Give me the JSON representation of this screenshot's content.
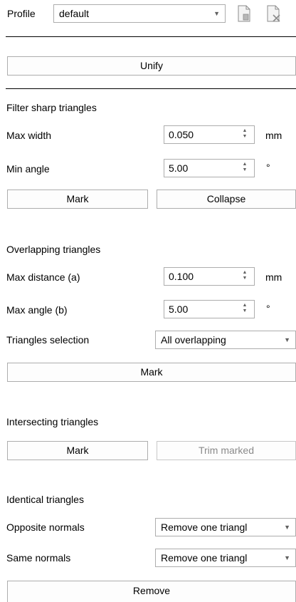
{
  "profile": {
    "label": "Profile",
    "selected": "default",
    "icons": [
      "save-document-icon",
      "delete-document-icon"
    ]
  },
  "unify_button": "Unify",
  "filter_sharp": {
    "title": "Filter sharp triangles",
    "max_width_label": "Max width",
    "max_width_value": "0.050",
    "max_width_unit": "mm",
    "min_angle_label": "Min angle",
    "min_angle_value": "5.00",
    "min_angle_unit": "°",
    "mark_button": "Mark",
    "collapse_button": "Collapse"
  },
  "overlapping": {
    "title": "Overlapping triangles",
    "max_distance_label": "Max distance (a)",
    "max_distance_value": "0.100",
    "max_distance_unit": "mm",
    "max_angle_label": "Max angle (b)",
    "max_angle_value": "5.00",
    "max_angle_unit": "°",
    "selection_label": "Triangles selection",
    "selection_value": "All overlapping",
    "mark_button": "Mark"
  },
  "intersecting": {
    "title": "Intersecting triangles",
    "mark_button": "Mark",
    "trim_button": "Trim marked"
  },
  "identical": {
    "title": "Identical triangles",
    "opposite_label": "Opposite normals",
    "opposite_value": "Remove one triangl",
    "same_label": "Same normals",
    "same_value": "Remove one triangl",
    "remove_button": "Remove"
  },
  "colors": {
    "border": "#adadad",
    "disabled_text": "#8a8a8a"
  }
}
